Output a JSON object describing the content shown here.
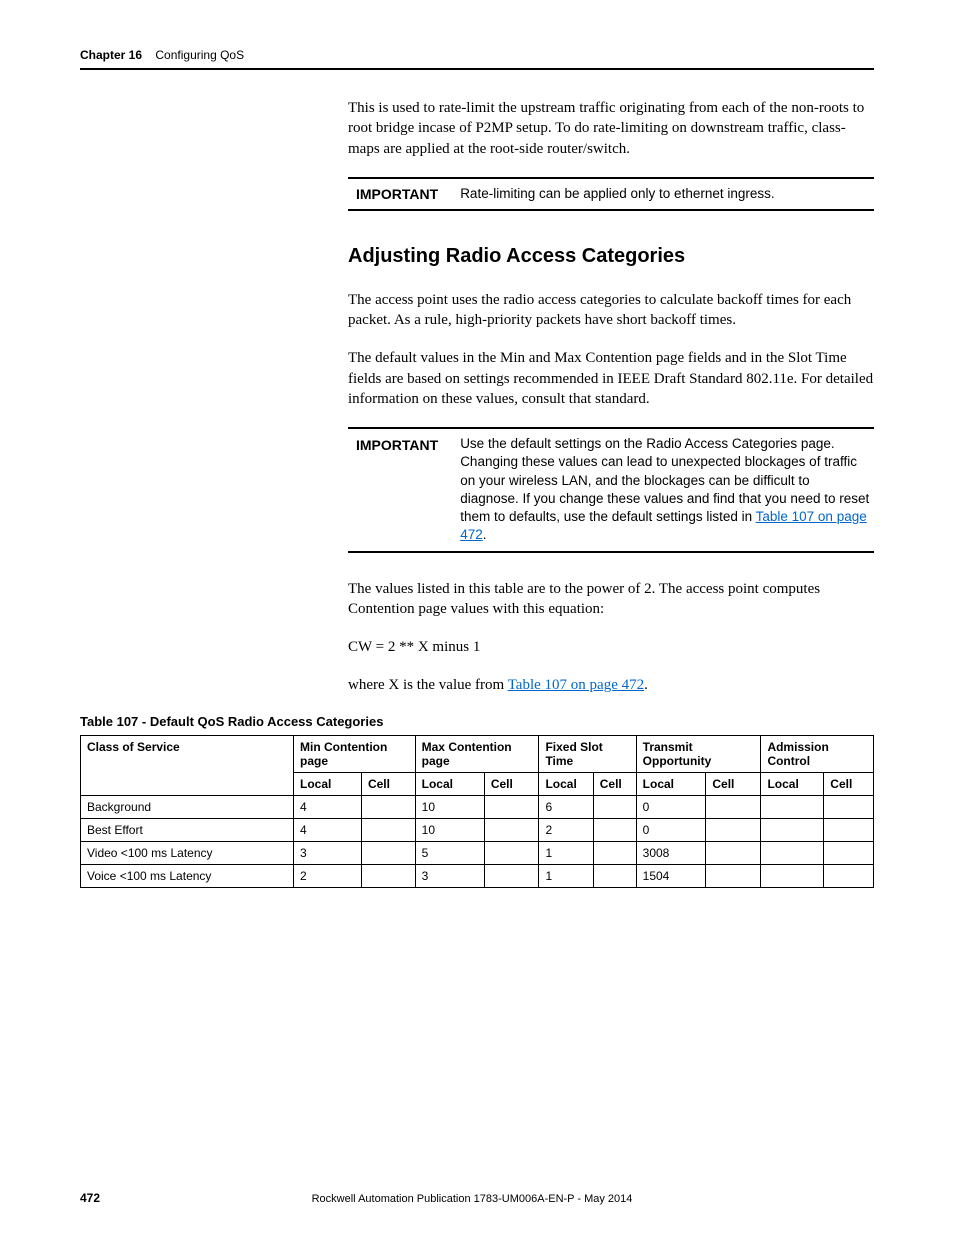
{
  "header": {
    "chapter_label": "Chapter 16",
    "chapter_title": "Configuring QoS"
  },
  "intro_para": "This is used to rate-limit the upstream traffic originating from each of the non-roots to root bridge incase of P2MP setup. To do rate-limiting on downstream traffic, class-maps are applied at the root-side router/switch.",
  "important1": {
    "label": "IMPORTANT",
    "text": "Rate-limiting can be applied only to ethernet ingress."
  },
  "section_heading": "Adjusting Radio Access Categories",
  "para2": "The access point uses the radio access categories to calculate backoff times for each packet. As a rule, high-priority packets have short backoff times.",
  "para3": "The default values in the Min and Max Contention page fields and in the Slot Time fields are based on settings recommended in IEEE Draft Standard 802.11e. For detailed information on these values, consult that standard.",
  "important2": {
    "label": "IMPORTANT",
    "text_before_link": "Use the default settings on the Radio Access Categories page. Changing these values can lead to unexpected blockages of traffic on your wireless LAN, and the blockages can be difficult to diagnose. If you change these values and find that you need to reset them to defaults, use the default settings listed in ",
    "link": "Table 107 on page 472",
    "text_after_link": "."
  },
  "para4": "The values listed in this table are to the power of 2. The access point computes Contention page values with this equation:",
  "equation": "CW = 2 ** X minus 1",
  "para5_before": "where X is the value from ",
  "para5_link": "Table 107 on page 472",
  "para5_after": ".",
  "table_title": "Table 107 - Default QoS Radio Access Categories",
  "table": {
    "top_headers": [
      "Class of Service",
      "Min Contention page",
      "Max Contention page",
      "Fixed Slot Time",
      "Transmit Opportunity",
      "Admission Control"
    ],
    "sub_headers": [
      "Local",
      "Cell",
      "Local",
      "Cell",
      "Local",
      "Cell",
      "Local",
      "Cell",
      "Local",
      "Cell"
    ],
    "rows": [
      {
        "class": "Background",
        "min_local": "4",
        "min_cell": "",
        "max_local": "10",
        "max_cell": "",
        "slot_local": "6",
        "slot_cell": "",
        "tx_local": "0",
        "tx_cell": "",
        "adm_local": "",
        "adm_cell": ""
      },
      {
        "class": "Best Effort",
        "min_local": "4",
        "min_cell": "",
        "max_local": "10",
        "max_cell": "",
        "slot_local": "2",
        "slot_cell": "",
        "tx_local": "0",
        "tx_cell": "",
        "adm_local": "",
        "adm_cell": ""
      },
      {
        "class": "Video <100 ms Latency",
        "min_local": "3",
        "min_cell": "",
        "max_local": "5",
        "max_cell": "",
        "slot_local": "1",
        "slot_cell": "",
        "tx_local": "3008",
        "tx_cell": "",
        "adm_local": "",
        "adm_cell": ""
      },
      {
        "class": "Voice <100 ms Latency",
        "min_local": "2",
        "min_cell": "",
        "max_local": "3",
        "max_cell": "",
        "slot_local": "1",
        "slot_cell": "",
        "tx_local": "1504",
        "tx_cell": "",
        "adm_local": "",
        "adm_cell": ""
      }
    ]
  },
  "footer": {
    "page": "472",
    "publication": "Rockwell Automation Publication 1783-UM006A-EN-P - May 2014"
  },
  "chart_data": {
    "type": "table",
    "title": "Table 107 - Default QoS Radio Access Categories",
    "columns": [
      "Class of Service",
      "Min Contention Local",
      "Min Contention Cell",
      "Max Contention Local",
      "Max Contention Cell",
      "Fixed Slot Local",
      "Fixed Slot Cell",
      "Transmit Opportunity Local",
      "Transmit Opportunity Cell",
      "Admission Control Local",
      "Admission Control Cell"
    ],
    "rows": [
      [
        "Background",
        4,
        null,
        10,
        null,
        6,
        null,
        0,
        null,
        null,
        null
      ],
      [
        "Best Effort",
        4,
        null,
        10,
        null,
        2,
        null,
        0,
        null,
        null,
        null
      ],
      [
        "Video <100 ms Latency",
        3,
        null,
        5,
        null,
        1,
        null,
        3008,
        null,
        null,
        null
      ],
      [
        "Voice <100 ms Latency",
        2,
        null,
        3,
        null,
        1,
        null,
        1504,
        null,
        null,
        null
      ]
    ]
  }
}
